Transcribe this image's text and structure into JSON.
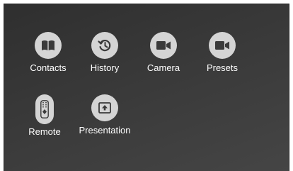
{
  "tiles": [
    {
      "label": "Contacts",
      "icon": "book-icon"
    },
    {
      "label": "History",
      "icon": "history-icon"
    },
    {
      "label": "Camera",
      "icon": "video-camera-icon"
    },
    {
      "label": "Presets",
      "icon": "video-camera-icon"
    },
    {
      "label": "Remote",
      "icon": "remote-control-icon"
    },
    {
      "label": "Presentation",
      "icon": "share-screen-icon"
    }
  ],
  "colors": {
    "icon_bg": "#d4d4d4",
    "icon_fg": "#3a3a3a",
    "label": "#ffffff",
    "panel_dark": "#2f2f2f",
    "panel_light": "#454545"
  }
}
